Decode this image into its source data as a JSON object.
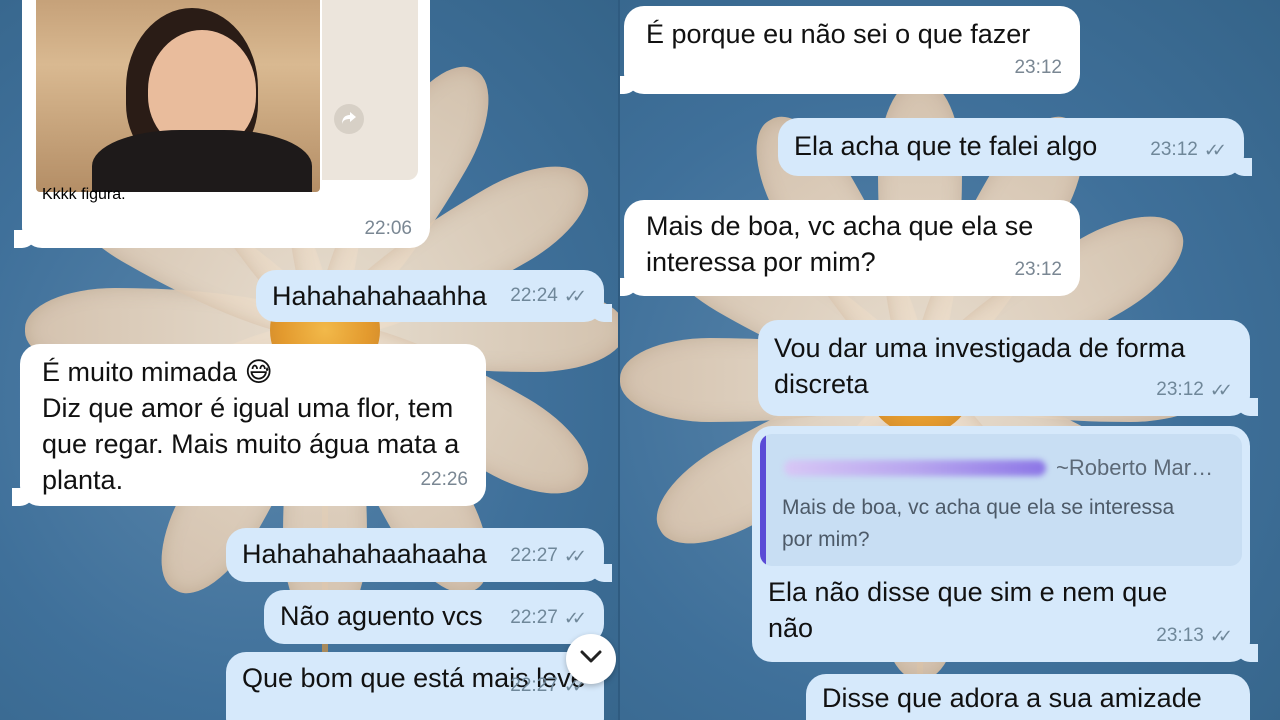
{
  "left_panel": {
    "photo_message": {
      "text": "Kkkk figura.",
      "time": "22:06"
    },
    "messages": [
      {
        "text": "Hahahahahaahha",
        "time": "22:24",
        "dir": "out"
      },
      {
        "text": "É muito mimada 😅\nDiz que amor é igual uma flor, tem\nque regar. Mais muito água mata a\nplanta.",
        "time": "22:26",
        "dir": "in"
      },
      {
        "text": "Hahahahahaahaaha",
        "time": "22:27",
        "dir": "out"
      },
      {
        "text": "Não aguento vcs",
        "time": "22:27",
        "dir": "out"
      },
      {
        "text": "Que bom que está mais leve",
        "time": "22:27",
        "dir": "out"
      }
    ],
    "scroll_down_icon": "chevron-down-icon",
    "forward_icon": "forward-icon"
  },
  "right_panel": {
    "messages": [
      {
        "text": "É porque eu não sei o que fazer",
        "time": "23:12",
        "dir": "in"
      },
      {
        "text": "Ela acha que te falei algo",
        "time": "23:12",
        "dir": "out"
      },
      {
        "text": "Mais de boa, vc acha que ela se\ninteressa por mim?",
        "time": "23:12",
        "dir": "in"
      },
      {
        "text": "Vou dar uma investigada de forma\ndiscreta",
        "time": "23:12",
        "dir": "out"
      },
      {
        "text": "Ela não disse que sim e nem que\nnão",
        "time": "23:13",
        "dir": "out"
      },
      {
        "text": "Disse que adora a sua amizade",
        "time": "",
        "dir": "out"
      }
    ],
    "quote": {
      "author": "~Roberto Mar…",
      "text": "Mais de boa, vc acha que ela se interessa\npor mim?"
    }
  },
  "colors": {
    "incoming": "#ffffff",
    "outgoing": "#d6e9fb",
    "wallpaper": "#3f709a",
    "quote_bar": "#5b4bd6"
  },
  "read_ticks": "✓✓"
}
